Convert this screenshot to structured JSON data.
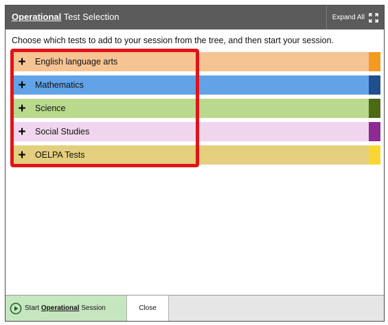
{
  "dialog": {
    "title_highlight": "Operational",
    "title_rest": " Test Selection",
    "expand_all_label": "Expand All",
    "expand_icon": "expand-arrows-icon"
  },
  "instructions": "Choose which tests to add to your session from the tree, and then start your session.",
  "tree": {
    "items": [
      {
        "label": "English language arts",
        "icon": "plus-icon",
        "bg_color": "#f6c493",
        "swatch_color": "#f39a1f"
      },
      {
        "label": "Mathematics",
        "icon": "plus-icon",
        "bg_color": "#62a3e8",
        "swatch_color": "#1f4f8e"
      },
      {
        "label": "Science",
        "icon": "plus-icon",
        "bg_color": "#b9d98c",
        "swatch_color": "#4c6a14"
      },
      {
        "label": "Social Studies",
        "icon": "plus-icon",
        "bg_color": "#efd6ee",
        "swatch_color": "#8d2a93"
      },
      {
        "label": "OELPA Tests",
        "icon": "plus-icon",
        "bg_color": "#e3cf7d",
        "swatch_color": "#fad633"
      }
    ]
  },
  "footer": {
    "start_prefix": "Start ",
    "start_highlight": "Operational",
    "start_suffix": " Session",
    "start_icon": "play-circle-icon",
    "close_label": "Close"
  },
  "colors": {
    "header_bg": "#5b5b5b",
    "highlight_border": "#e01418",
    "start_button_bg": "#c6e6bf"
  }
}
